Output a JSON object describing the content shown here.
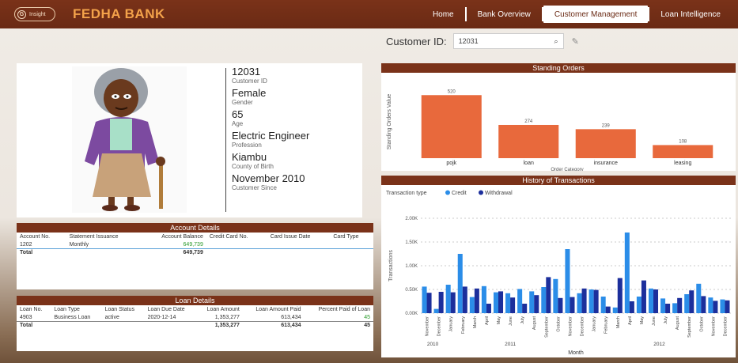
{
  "header": {
    "logo_text": "Insight",
    "logo_letter": "G",
    "bank_name": "FEDHA BANK",
    "nav": [
      "Home",
      "Bank Overview",
      "Customer Management",
      "Loan Intelligence"
    ],
    "active_nav": 2
  },
  "search": {
    "label": "Customer ID:",
    "value": "12031"
  },
  "profile": [
    {
      "value": "12031",
      "label": "Customer ID"
    },
    {
      "value": "Female",
      "label": "Gender"
    },
    {
      "value": "65",
      "label": "Age"
    },
    {
      "value": "Electric Engineer",
      "label": "Profession"
    },
    {
      "value": "Kiambu",
      "label": "County of Birth"
    },
    {
      "value": "November 2010",
      "label": "Customer Since"
    }
  ],
  "account": {
    "title": "Account Details",
    "headers": [
      "Account No.",
      "Statement Issuance",
      "Account Balance",
      "Credit Card No.",
      "Card Issue Date",
      "Card Type"
    ],
    "rows": [
      [
        "1202",
        "Monthly",
        "649,739",
        "",
        "",
        ""
      ]
    ],
    "total": [
      "Total",
      "",
      "649,739",
      "",
      "",
      ""
    ]
  },
  "loan": {
    "title": "Loan Details",
    "headers": [
      "Loan No.",
      "Loan Type",
      "Loan Status",
      "Loan Due Date",
      "Loan Amount",
      "Loan Amount Paid",
      "Percent Paid of Loan"
    ],
    "rows": [
      [
        "4903",
        "Business Loan",
        "active",
        "2020-12-14",
        "1,353,277",
        "613,434",
        "45"
      ]
    ],
    "total": [
      "Total",
      "",
      "",
      "",
      "1,353,277",
      "613,434",
      "45"
    ]
  },
  "chart_data": [
    {
      "type": "bar",
      "title": "Standing Orders",
      "categories": [
        "pojk",
        "loan",
        "insurance",
        "leasing"
      ],
      "values": [
        520,
        274,
        239,
        108
      ],
      "xlabel": "Order Category",
      "ylabel": "Standing Orders Value",
      "color": "#e8693c",
      "ylim": [
        0,
        600
      ]
    },
    {
      "type": "bar",
      "title": "History of Transactions",
      "legend_title": "Transaction type",
      "series_names": [
        "Credit",
        "Withdrawal"
      ],
      "colors": [
        "#2b8de8",
        "#1c2f9c"
      ],
      "xlabel": "Month",
      "ylabel": "Transactions",
      "ytick_labels": [
        "0.00K",
        "0.50K",
        "1.00K",
        "1.50K",
        "2.00K"
      ],
      "ylim": [
        0,
        2000
      ],
      "years": [
        "2010",
        "2011",
        "2012"
      ],
      "categories": [
        "November",
        "December",
        "January",
        "February",
        "March",
        "April",
        "May",
        "June",
        "July",
        "August",
        "September",
        "October",
        "November",
        "December",
        "January",
        "February",
        "March",
        "April",
        "May",
        "June",
        "July",
        "August",
        "September",
        "October",
        "November",
        "December"
      ],
      "credit": [
        560,
        90,
        600,
        1250,
        340,
        570,
        440,
        420,
        510,
        460,
        550,
        720,
        1350,
        420,
        500,
        350,
        120,
        1700,
        350,
        520,
        310,
        210,
        400,
        620,
        330,
        290
      ],
      "withdrawal": [
        430,
        450,
        440,
        560,
        520,
        200,
        460,
        330,
        200,
        380,
        760,
        320,
        340,
        520,
        490,
        140,
        740,
        250,
        690,
        500,
        200,
        320,
        480,
        360,
        260,
        270
      ]
    }
  ]
}
